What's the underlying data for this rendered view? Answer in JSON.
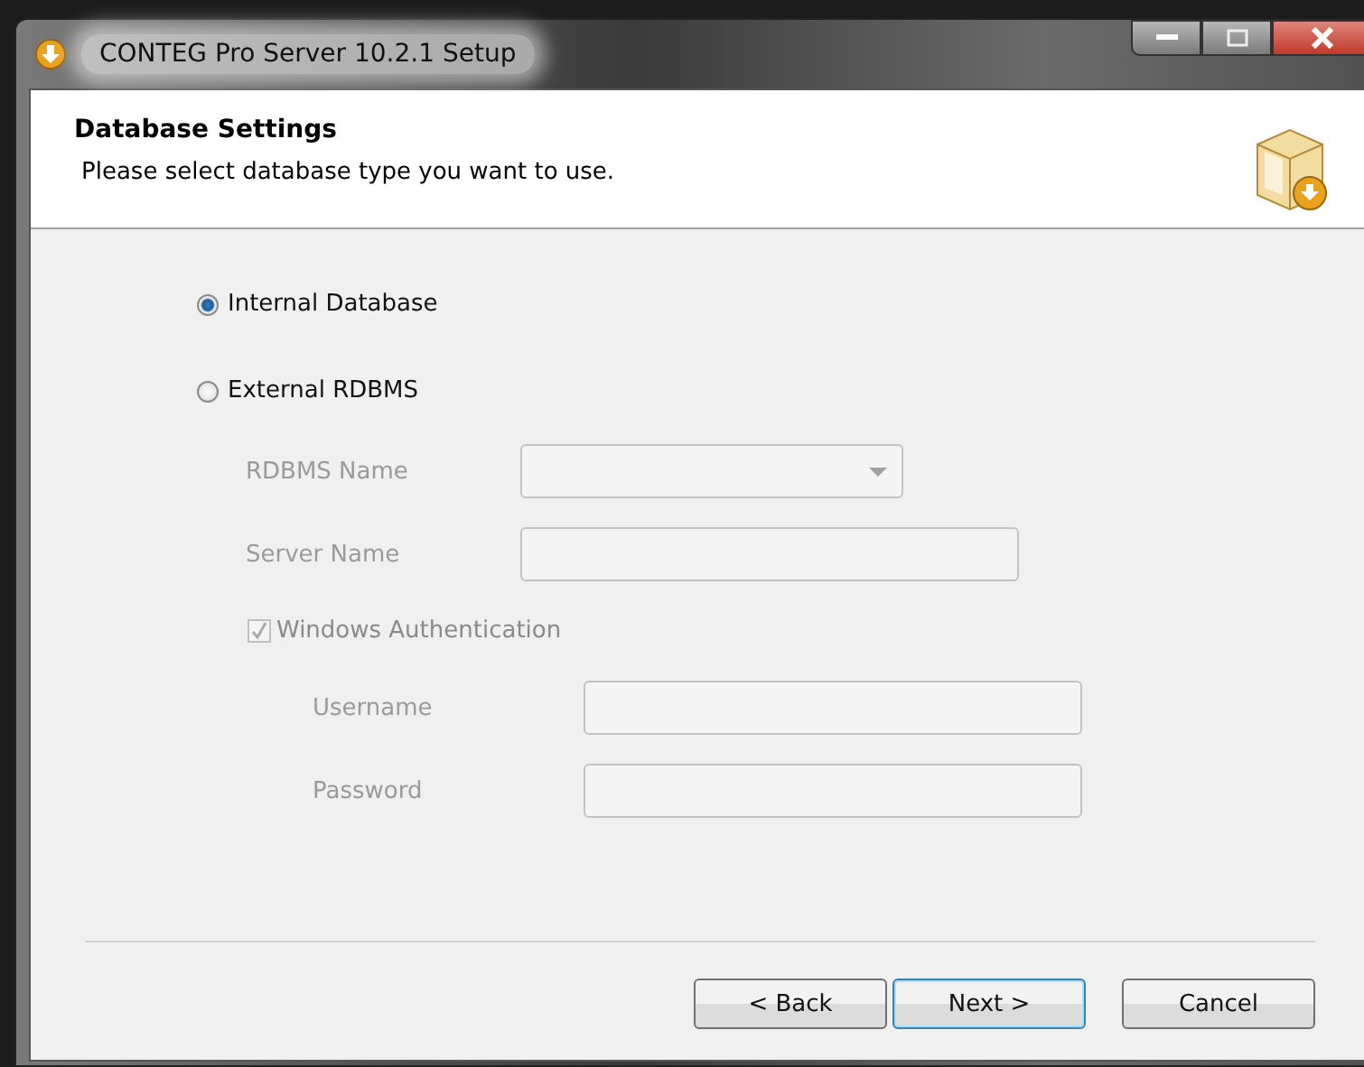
{
  "window": {
    "title": "CONTEG Pro Server 10.2.1 Setup"
  },
  "header": {
    "title": "Database Settings",
    "subtitle": "Please select database type you want to use."
  },
  "options": [
    {
      "label": "Internal Database",
      "selected": true
    },
    {
      "label": "External RDBMS",
      "selected": false
    }
  ],
  "db_fields": [
    {
      "label": "RDBMS Name",
      "kind": "combo",
      "disabled": true
    },
    {
      "label": "Server Name",
      "kind": "text",
      "disabled": true
    }
  ],
  "auth_checkbox": {
    "label": "Windows Authentication",
    "checked": true,
    "disabled": true
  },
  "auth_fields": [
    {
      "label": "Username",
      "kind": "text",
      "disabled": true
    },
    {
      "label": "Password",
      "kind": "text",
      "disabled": true
    }
  ],
  "buttons": [
    {
      "label": "< Back",
      "default": false
    },
    {
      "label": "Next >",
      "default": true
    },
    {
      "label": "Cancel",
      "default": false
    }
  ]
}
